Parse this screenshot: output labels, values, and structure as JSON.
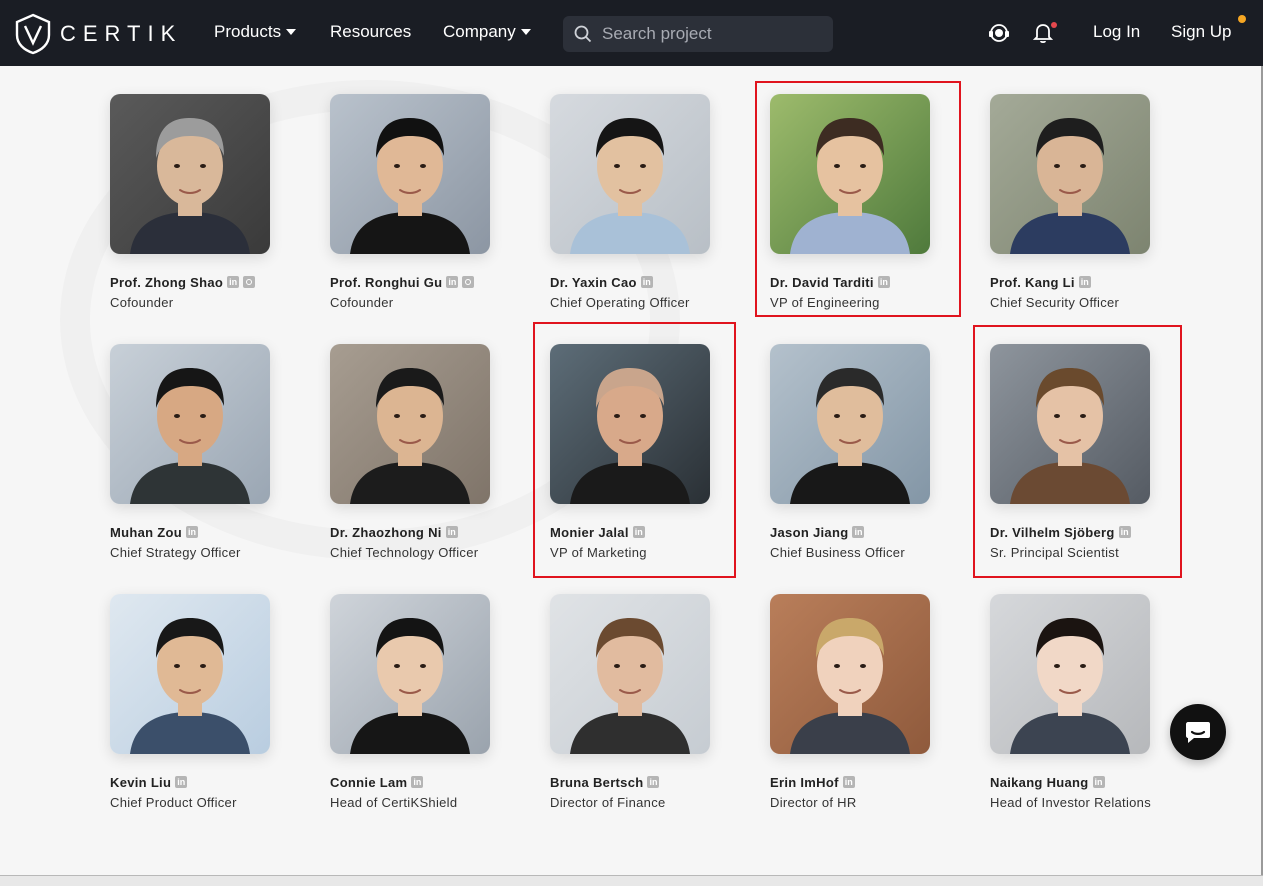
{
  "nav": {
    "logo_text": "CERTIK",
    "items": [
      {
        "label": "Products"
      },
      {
        "label": "Resources"
      },
      {
        "label": "Company"
      }
    ],
    "search_placeholder": "Search project",
    "support_icon": "support-24-7-icon",
    "bell_icon": "bell-icon",
    "login_label": "Log In",
    "signup_label": "Sign Up"
  },
  "team": [
    {
      "name": "Prof. Zhong Shao",
      "role": "Cofounder",
      "linkedin": "in",
      "has_link": true
    },
    {
      "name": "Prof. Ronghui Gu",
      "role": "Cofounder",
      "linkedin": "in",
      "has_link": true
    },
    {
      "name": "Dr. Yaxin Cao",
      "role": "Chief Operating Officer",
      "linkedin": "in",
      "has_link": false
    },
    {
      "name": "Dr. David Tarditi",
      "role": "VP of Engineering",
      "linkedin": "in",
      "has_link": false
    },
    {
      "name": "Prof. Kang Li",
      "role": "Chief Security Officer",
      "linkedin": "in",
      "has_link": false
    },
    {
      "name": "Muhan Zou",
      "role": "Chief Strategy Officer",
      "linkedin": "in",
      "has_link": false
    },
    {
      "name": "Dr. Zhaozhong Ni",
      "role": "Chief Technology Officer",
      "linkedin": "in",
      "has_link": false
    },
    {
      "name": "Monier Jalal",
      "role": "VP of Marketing",
      "linkedin": "in",
      "has_link": false
    },
    {
      "name": "Jason Jiang",
      "role": "Chief Business Officer",
      "linkedin": "in",
      "has_link": false
    },
    {
      "name": "Dr. Vilhelm Sjöberg",
      "role": "Sr. Principal Scientist",
      "linkedin": "in",
      "has_link": false
    },
    {
      "name": "Kevin Liu",
      "role": "Chief Product Officer",
      "linkedin": "in",
      "has_link": false
    },
    {
      "name": "Connie Lam",
      "role": "Head of CertiKShield",
      "linkedin": "in",
      "has_link": false
    },
    {
      "name": "Bruna Bertsch",
      "role": "Director of Finance",
      "linkedin": "in",
      "has_link": false
    },
    {
      "name": "Erin ImHof",
      "role": "Director of HR",
      "linkedin": "in",
      "has_link": false
    },
    {
      "name": "Naikang Huang",
      "role": "Head of Investor Relations",
      "linkedin": "in",
      "has_link": false
    }
  ],
  "colors": {
    "nav_bg": "#1a1d24",
    "highlight": "#e0141e",
    "page_bg": "#f6f6f6"
  }
}
